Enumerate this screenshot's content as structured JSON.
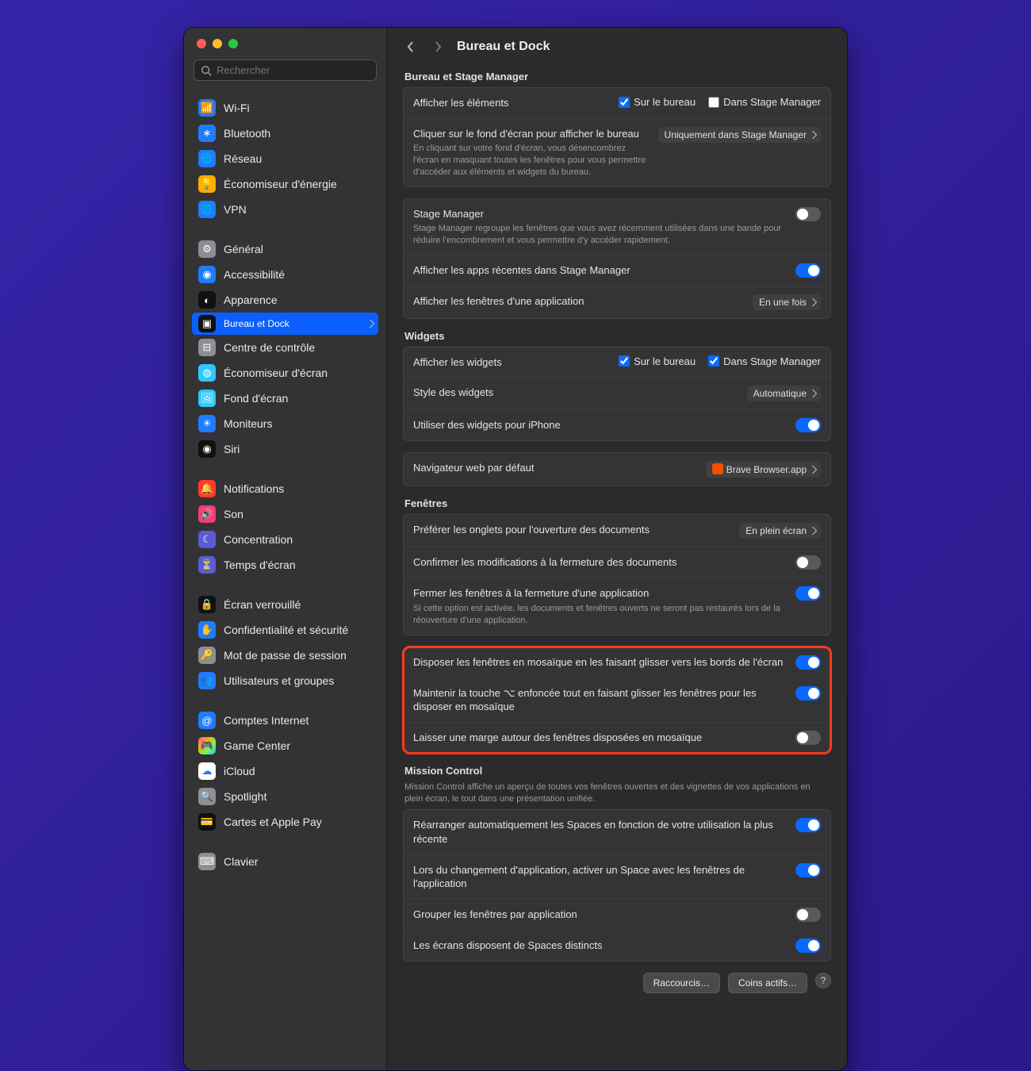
{
  "search_placeholder": "Rechercher",
  "title": "Bureau et Dock",
  "sidebar": [
    {
      "label": "Wi-Fi",
      "icon": "wifi",
      "bg": "#1f7cff"
    },
    {
      "label": "Bluetooth",
      "icon": "bt",
      "bg": "#1f7cff"
    },
    {
      "label": "Réseau",
      "icon": "net",
      "bg": "#1f7cff"
    },
    {
      "label": "Économiseur d'énergie",
      "icon": "bulb",
      "bg": "#ffab00"
    },
    {
      "label": "VPN",
      "icon": "vpn",
      "bg": "#1f7cff"
    },
    {
      "gap": true
    },
    {
      "label": "Général",
      "icon": "gear",
      "bg": "#8e8e93"
    },
    {
      "label": "Accessibilité",
      "icon": "acc",
      "bg": "#1f7cff"
    },
    {
      "label": "Apparence",
      "icon": "appear",
      "bg": "#111"
    },
    {
      "label": "Bureau et Dock",
      "icon": "dock",
      "bg": "#111",
      "selected": true
    },
    {
      "label": "Centre de contrôle",
      "icon": "cc",
      "bg": "#8e8e93"
    },
    {
      "label": "Économiseur d'écran",
      "icon": "ss",
      "bg": "#2ec8ff"
    },
    {
      "label": "Fond d'écran",
      "icon": "wall",
      "bg": "#2ec8ff"
    },
    {
      "label": "Moniteurs",
      "icon": "disp",
      "bg": "#1f7cff"
    },
    {
      "label": "Siri",
      "icon": "siri",
      "bg": "#111"
    },
    {
      "gap": true
    },
    {
      "label": "Notifications",
      "icon": "bell",
      "bg": "#ff3b30"
    },
    {
      "label": "Son",
      "icon": "sound",
      "bg": "#ff3b75"
    },
    {
      "label": "Concentration",
      "icon": "focus",
      "bg": "#5b5bd6"
    },
    {
      "label": "Temps d'écran",
      "icon": "time",
      "bg": "#5b5bd6"
    },
    {
      "gap": true
    },
    {
      "label": "Écran verrouillé",
      "icon": "lock",
      "bg": "#111"
    },
    {
      "label": "Confidentialité et sécurité",
      "icon": "hand",
      "bg": "#1f7cff"
    },
    {
      "label": "Mot de passe de session",
      "icon": "key",
      "bg": "#8e8e93"
    },
    {
      "label": "Utilisateurs et groupes",
      "icon": "users",
      "bg": "#1f7cff"
    },
    {
      "gap": true
    },
    {
      "label": "Comptes Internet",
      "icon": "at",
      "bg": "#1f7cff"
    },
    {
      "label": "Game Center",
      "icon": "gc",
      "bg": "linear-gradient(135deg,#ff44cc,#ffa800,#66ff66,#33aaff)"
    },
    {
      "label": "iCloud",
      "icon": "cloud",
      "bg": "#fff",
      "fg": "#1f7cff"
    },
    {
      "label": "Spotlight",
      "icon": "spot",
      "bg": "#8e8e93"
    },
    {
      "label": "Cartes et Apple Pay",
      "icon": "pay",
      "bg": "#111"
    },
    {
      "gap": true
    },
    {
      "label": "Clavier",
      "icon": "kb",
      "bg": "#8e8e93"
    }
  ],
  "sec_bsm": "Bureau et Stage Manager",
  "show_items": "Afficher les éléments",
  "on_desktop": "Sur le bureau",
  "in_sm": "Dans Stage Manager",
  "click_wall": "Cliquer sur le fond d'écran pour afficher le bureau",
  "click_wall_desc": "En cliquant sur votre fond d'écran, vous désencombrez l'écran en masquant toutes les fenêtres pour vous permettre d'accéder aux éléments et widgets du bureau.",
  "click_wall_val": "Uniquement dans Stage Manager",
  "sm_label": "Stage Manager",
  "sm_desc": "Stage Manager regroupe les fenêtres que vous avez récemment utilisées dans une bande pour réduire l'encombrement et vous permettre d'y accéder rapidement.",
  "sm_recent": "Afficher les apps récentes dans Stage Manager",
  "sm_windows": "Afficher les fenêtres d'une application",
  "sm_windows_val": "En une fois",
  "sec_widgets": "Widgets",
  "show_widgets": "Afficher les widgets",
  "widget_style": "Style des widgets",
  "widget_style_val": "Automatique",
  "widget_iphone": "Utiliser des widgets pour iPhone",
  "default_browser": "Navigateur web par défaut",
  "default_browser_val": "Brave Browser.app",
  "sec_windows": "Fenêtres",
  "prefer_tabs": "Préférer les onglets pour l'ouverture des documents",
  "prefer_tabs_val": "En plein écran",
  "confirm_close": "Confirmer les modifications à la fermeture des documents",
  "close_windows": "Fermer les fenêtres à la fermeture d'une application",
  "close_windows_desc": "Si cette option est activée, les documents et fenêtres ouverts ne seront pas restaurés lors de la réouverture d'une application.",
  "tile_drag": "Disposer les fenêtres en mosaïque en les faisant glisser vers les bords de l'écran",
  "tile_opt": "Maintenir la touche ⌥ enfoncée tout en faisant glisser les fenêtres pour les disposer en mosaïque",
  "tile_margin": "Laisser une marge autour des fenêtres disposées en mosaïque",
  "sec_mc": "Mission Control",
  "mc_desc": "Mission Control affiche un aperçu de toutes vos fenêtres ouvertes et des vignettes de vos applications en plein écran, le tout dans une présentation unifiée.",
  "mc_rearrange": "Réarranger automatiquement les Spaces en fonction de votre utilisation la plus récente",
  "mc_switch": "Lors du changement d'application, activer un Space avec les fenêtres de l'application",
  "mc_group": "Grouper les fenêtres par application",
  "mc_displays": "Les écrans disposent de Spaces distincts",
  "btn_shortcuts": "Raccourcis…",
  "btn_corners": "Coins actifs…"
}
